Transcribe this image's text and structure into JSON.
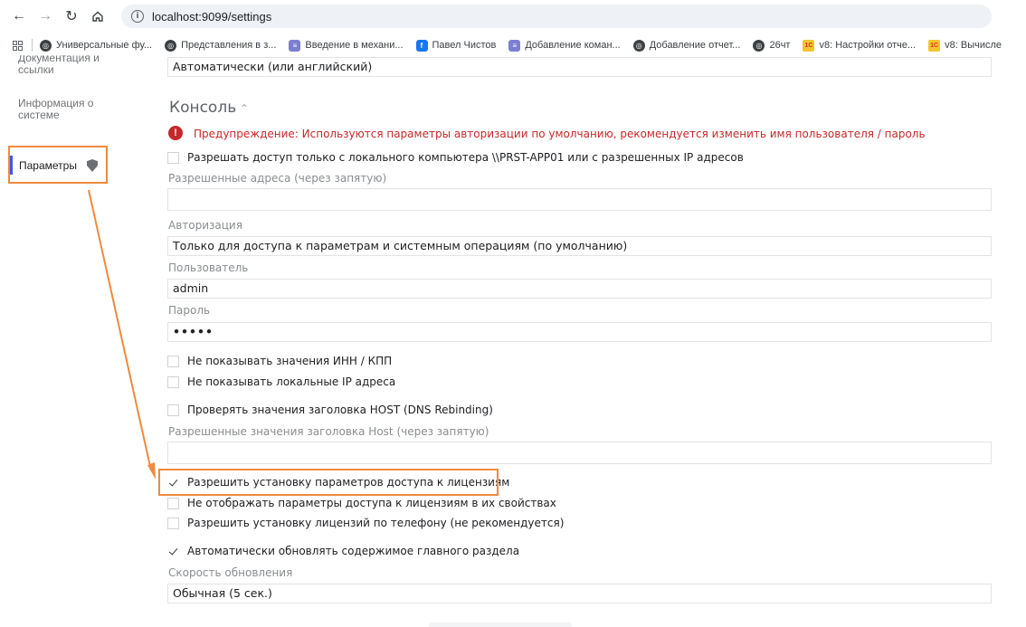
{
  "browser": {
    "url": "localhost:9099/settings",
    "bookmarks": [
      {
        "label": "Универсальные фу...",
        "icon": "globe"
      },
      {
        "label": "Представления в з...",
        "icon": "globe"
      },
      {
        "label": "Введение в механи...",
        "icon": "doc"
      },
      {
        "label": "Павел Чистов",
        "icon": "fb"
      },
      {
        "label": "Добавление коман...",
        "icon": "doc"
      },
      {
        "label": "Добавление отчет...",
        "icon": "globe"
      },
      {
        "label": "26чт",
        "icon": "globe"
      },
      {
        "label": "v8: Настройки отче...",
        "icon": "v8"
      },
      {
        "label": "v8: Вычисле",
        "icon": "v8"
      }
    ]
  },
  "sidebar": {
    "docs_line1": "Документация и",
    "docs_line2": "ссылки",
    "sysinfo_line1": "Информация о",
    "sysinfo_line2": "системе",
    "params": "Параметры"
  },
  "main": {
    "language_value": "Автоматически (или английский)",
    "console_title": "Консоль",
    "warning": "Предупреждение: Используются параметры авторизации по умолчанию, рекомендуется изменить имя пользователя / пароль",
    "cb_local_access": "Разрешать доступ только с локального компьютера \\\\PRST-APP01 или с разрешенных IP адресов",
    "allowed_addresses_label": "Разрешенные адреса (через запятую)",
    "allowed_addresses_value": "",
    "auth_label": "Авторизация",
    "auth_value": "Только для доступа к параметрам и системным операциям (по умолчанию)",
    "user_label": "Пользователь",
    "user_value": "admin",
    "password_label": "Пароль",
    "password_value": "•••••",
    "cb_hide_inn": "Не показывать значения ИНН / КПП",
    "cb_hide_ip": "Не показывать локальные IP адреса",
    "cb_check_host": "Проверять значения заголовка HOST (DNS Rebinding)",
    "allowed_host_label": "Разрешенные значения заголовка Host (через запятую)",
    "allowed_host_value": "",
    "cb_allow_license_params": "Разрешить установку параметров доступа к лицензиям",
    "cb_hide_license_params": "Не отображать параметры доступа к лицензиям в их свойствах",
    "cb_phone_license": "Разрешить установку лицензий по телефону (не рекомендуется)",
    "cb_auto_refresh": "Автоматически обновлять содержимое главного раздела",
    "refresh_speed_label": "Скорость обновления",
    "refresh_speed_value": "Обычная (5 сек.)"
  },
  "states": {
    "cb_local_access": false,
    "cb_hide_inn": false,
    "cb_hide_ip": false,
    "cb_check_host": false,
    "cb_allow_license_params": true,
    "cb_hide_license_params": false,
    "cb_phone_license": false,
    "cb_auto_refresh": true
  },
  "colors": {
    "annotation_orange": "#f08a3c",
    "warning_red": "#c5282b",
    "active_blue": "#3b5bdb"
  }
}
